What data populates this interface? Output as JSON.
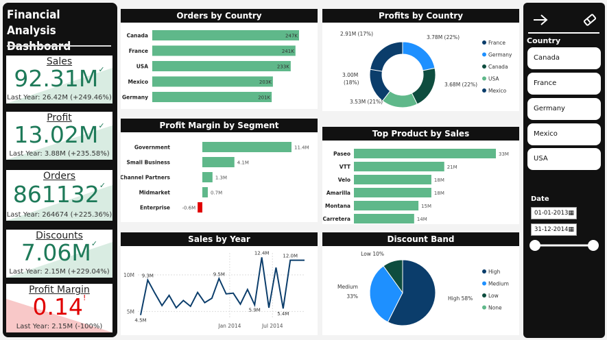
{
  "app_title": "Financial Analysis Dashboard",
  "kpis": {
    "sales": {
      "label": "Sales",
      "value": "92.31M",
      "sub": "Last Year: 26.42M (+249.46%)"
    },
    "profit": {
      "label": "Profit",
      "value": "13.02M",
      "sub": "Last Year: 3.88M (+235.58%)"
    },
    "orders": {
      "label": "Orders",
      "value": "861132",
      "sub": "Last Year: 264674 (+225.36%)"
    },
    "discounts": {
      "label": "Discounts",
      "value": "7.06M",
      "sub": "Last Year: 2.15M (+229.04%)"
    },
    "margin": {
      "label": "Profit Margin",
      "value": "0.14",
      "sub": "Last Year: 2.15M (-100%)"
    }
  },
  "colors": {
    "green": "#5fb88a",
    "dark_green": "#1e7a59",
    "red": "#e00000",
    "navy": "#0b3d6b",
    "blue": "#1e90ff",
    "teal": "#0e4d3f"
  },
  "filters": {
    "country_label": "Country",
    "countries": [
      "Canada",
      "France",
      "Germany",
      "Mexico",
      "USA"
    ],
    "date_label": "Date",
    "date_from": "01-01-2013",
    "date_to": "31-12-2014"
  },
  "chart_data": [
    {
      "id": "orders-by-country",
      "type": "bar",
      "title": "Orders by Country",
      "categories": [
        "Canada",
        "France",
        "USA",
        "Mexico",
        "Germany"
      ],
      "values": [
        247,
        241,
        233,
        203,
        201
      ],
      "labels": [
        "247K",
        "241K",
        "233K",
        "203K",
        "201K"
      ]
    },
    {
      "id": "profits-by-country",
      "type": "pie",
      "title": "Profits by Country",
      "categories": [
        "France",
        "Germany",
        "Canada",
        "USA",
        "Mexico"
      ],
      "values": [
        3.68,
        3.53,
        3.0,
        2.91,
        3.78
      ],
      "labels": [
        "3.68M (22%)",
        "3.53M (21%)",
        "3.00M (18%)",
        "2.91M (17%)",
        "3.78M (22%)"
      ],
      "colors": [
        "#1e90ff",
        "#0e4d3f",
        "#5fb88a",
        "#0b3d6b",
        "#0b3d6b"
      ]
    },
    {
      "id": "profit-margin-by-segment",
      "type": "bar",
      "title": "Profit Margin by Segment",
      "categories": [
        "Government",
        "Small Business",
        "Channel Partners",
        "Midmarket",
        "Enterprise"
      ],
      "values": [
        11.4,
        4.1,
        1.3,
        0.7,
        -0.6
      ],
      "labels": [
        "11.4M",
        "4.1M",
        "1.3M",
        "0.7M",
        "-0.6M"
      ]
    },
    {
      "id": "top-product-by-sales",
      "type": "bar",
      "title": "Top Product by Sales",
      "categories": [
        "Paseo",
        "VTT",
        "Velo",
        "Amarilla",
        "Montana",
        "Carretera"
      ],
      "values": [
        33,
        21,
        18,
        18,
        15,
        14
      ],
      "labels": [
        "33M",
        "21M",
        "18M",
        "18M",
        "15M",
        "14M"
      ]
    },
    {
      "id": "sales-by-year",
      "type": "line",
      "title": "Sales by Year",
      "x": [
        1,
        2,
        3,
        4,
        5,
        6,
        7,
        8,
        9,
        10,
        11,
        12,
        13,
        14,
        15,
        16,
        17,
        18,
        19,
        20,
        21,
        22,
        23,
        24
      ],
      "y": [
        4.5,
        9.3,
        7.5,
        5.8,
        7.2,
        5.5,
        6.5,
        5.7,
        7.6,
        6.2,
        6.8,
        9.5,
        7.4,
        7.5,
        6.0,
        8.0,
        5.9,
        12.4,
        5.5,
        11.0,
        5.4,
        12.0,
        12.0,
        12.0
      ],
      "point_labels": [
        "4.5M",
        "9.3M",
        "9.5M",
        "5.9M",
        "12.4M",
        "5.4M",
        "12.0M"
      ],
      "y_ticks": [
        "10M",
        "5M"
      ],
      "x_ticks": [
        "Jan 2014",
        "Jul 2014"
      ]
    },
    {
      "id": "discount-band",
      "type": "pie",
      "title": "Discount Band",
      "categories": [
        "High",
        "Medium",
        "Low",
        "None"
      ],
      "values": [
        58,
        33,
        10,
        0
      ],
      "labels": [
        "High 58%",
        "Medium 33%",
        "Low 10%"
      ],
      "colors": [
        "#0b3d6b",
        "#1e90ff",
        "#0e4d3f",
        "#5fb88a"
      ]
    }
  ]
}
